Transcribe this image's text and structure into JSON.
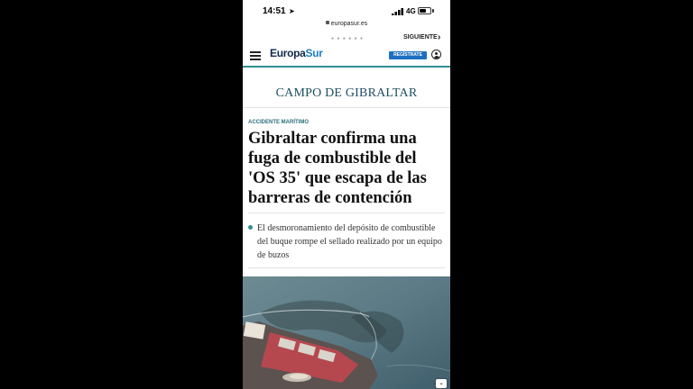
{
  "status_bar": {
    "time": "14:51",
    "network": "4G",
    "battery_level": 0.6
  },
  "browser": {
    "url": "europasur.es"
  },
  "nav": {
    "next_label": "SIGUIENTE"
  },
  "header": {
    "logo_part1": "Europa",
    "logo_part2": "Sur",
    "register_label": "REGÍSTRATE"
  },
  "article": {
    "section": "CAMPO DE GIBRALTAR",
    "kicker": "ACCIDENTE MARÍTIMO",
    "headline": "Gibraltar confirma una fuga de combustible del 'OS 35' que escapa de las barreras de contención",
    "lead": "El desmoronamiento del depósito de combustible del buque rompe el sellado realizado por un equipo de buzos"
  },
  "colors": {
    "accent_teal": "#2f8f8f",
    "section_color": "#1d4e63",
    "register_blue": "#1e6fc0",
    "logo_navy": "#12294a",
    "logo_blue": "#1a7fc4"
  }
}
